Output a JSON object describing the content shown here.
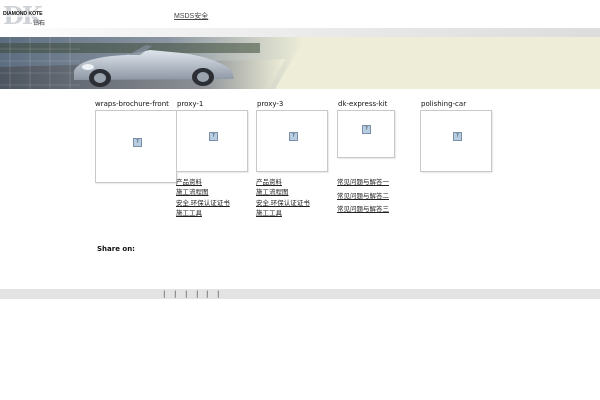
{
  "header": {
    "logo_mark": "DK",
    "logo_brand": "DIAMOND KOTE",
    "logo_cn": "钻石",
    "top_link": "MSDS安全"
  },
  "banner": {
    "image": "silver-convertible-car-icon",
    "colors": {
      "banner_bg": "#eeeed8",
      "car": "#a9b3bf",
      "road": "#6a6f78"
    }
  },
  "gallery": [
    {
      "caption": "wraps-brochure-front",
      "links": []
    },
    {
      "caption": "proxy-1",
      "links": [
        "产品资料",
        "施工流程图",
        "安全.环保认证证书",
        "施工工具"
      ]
    },
    {
      "caption": "proxy-3",
      "links": [
        "产品资料",
        "施工流程图",
        "安全.环保认证证书",
        "施工工具"
      ]
    },
    {
      "caption": "dk-express-kit",
      "links": [
        "常见问题与解答一",
        "常见问题与解答二",
        "常见问题与解答三"
      ]
    },
    {
      "caption": "polishing-car",
      "links": []
    }
  ],
  "share": {
    "label": "Share on:"
  },
  "footer": {
    "separators": [
      "|",
      "|",
      "|",
      "|",
      "|",
      "|"
    ]
  }
}
